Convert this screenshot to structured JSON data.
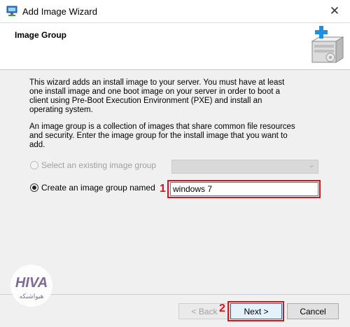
{
  "window": {
    "title": "Add Image Wizard",
    "close_glyph": "✕"
  },
  "header": {
    "title": "Image Group",
    "icon": "server-add-icon"
  },
  "content": {
    "intro": "This wizard adds an install image to your server. You must have at least one install image and one boot image on your server in order to boot a client using Pre-Boot Execution Environment (PXE) and install an operating system.",
    "description": "An image group is a collection of images that share common file resources and security. Enter the image group for the install image that you want to add.",
    "option_existing": {
      "label": "Select an existing image group",
      "selected": false,
      "enabled": false,
      "value": ""
    },
    "option_create": {
      "label": "Create an image group named",
      "selected": true,
      "value": "windows 7"
    }
  },
  "annotations": {
    "marker1": "1",
    "marker2": "2"
  },
  "buttons": {
    "back": "< Back",
    "next": "Next >",
    "cancel": "Cancel"
  },
  "watermark": {
    "brand": "HIVA",
    "text": "هیواشبکه"
  },
  "colors": {
    "highlight": "#e0101a",
    "focus": "#0078d7",
    "watermark": "#7d6a96"
  }
}
